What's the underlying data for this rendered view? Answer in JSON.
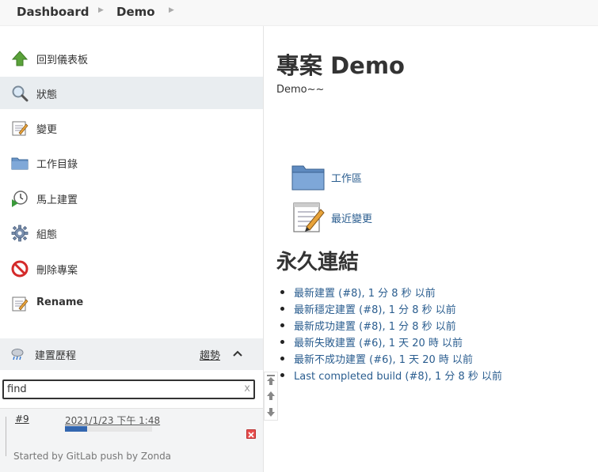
{
  "breadcrumb": {
    "items": [
      {
        "label": "Dashboard"
      },
      {
        "label": "Demo"
      }
    ]
  },
  "sidebar": {
    "tasks": [
      {
        "label": "回到儀表板",
        "icon": "up-arrow-icon"
      },
      {
        "label": "狀態",
        "icon": "magnifier-icon",
        "active": true
      },
      {
        "label": "變更",
        "icon": "notepad-icon"
      },
      {
        "label": "工作目錄",
        "icon": "folder-icon"
      },
      {
        "label": "馬上建置",
        "icon": "clock-play-icon"
      },
      {
        "label": "組態",
        "icon": "gear-icon"
      },
      {
        "label": "刪除專案",
        "icon": "no-entry-icon"
      },
      {
        "label": "Rename",
        "icon": "notepad-icon"
      }
    ]
  },
  "build_history": {
    "title": "建置歷程",
    "trend": "趨勢",
    "search_value": "find",
    "search_clear": "x",
    "builds": [
      {
        "number": "#9",
        "date": "2021/1/23 下午 1:48",
        "progress": 0.25,
        "cause": "Started by GitLab push by Zonda"
      }
    ]
  },
  "main": {
    "title": "專案 Demo",
    "description": "Demo~~",
    "links": [
      {
        "label": "工作區",
        "icon": "folder-icon"
      },
      {
        "label": "最近變更",
        "icon": "notepad-icon"
      }
    ],
    "permalinks_title": "永久連結",
    "permalinks": [
      "最新建置 (#8), 1 分 8 秒 以前",
      "最新穩定建置 (#8), 1 分 8 秒 以前",
      "最新成功建置 (#8), 1 分 8 秒 以前",
      "最新失敗建置 (#6), 1 天 20 時 以前",
      "最新不成功建置 (#6), 1 天 20 時 以前",
      "Last completed build (#8), 1 分 8 秒 以前"
    ]
  },
  "colors": {
    "link": "#2a5d8f",
    "sidebar_active": "#e9edf0",
    "progress": "#3367b0"
  }
}
